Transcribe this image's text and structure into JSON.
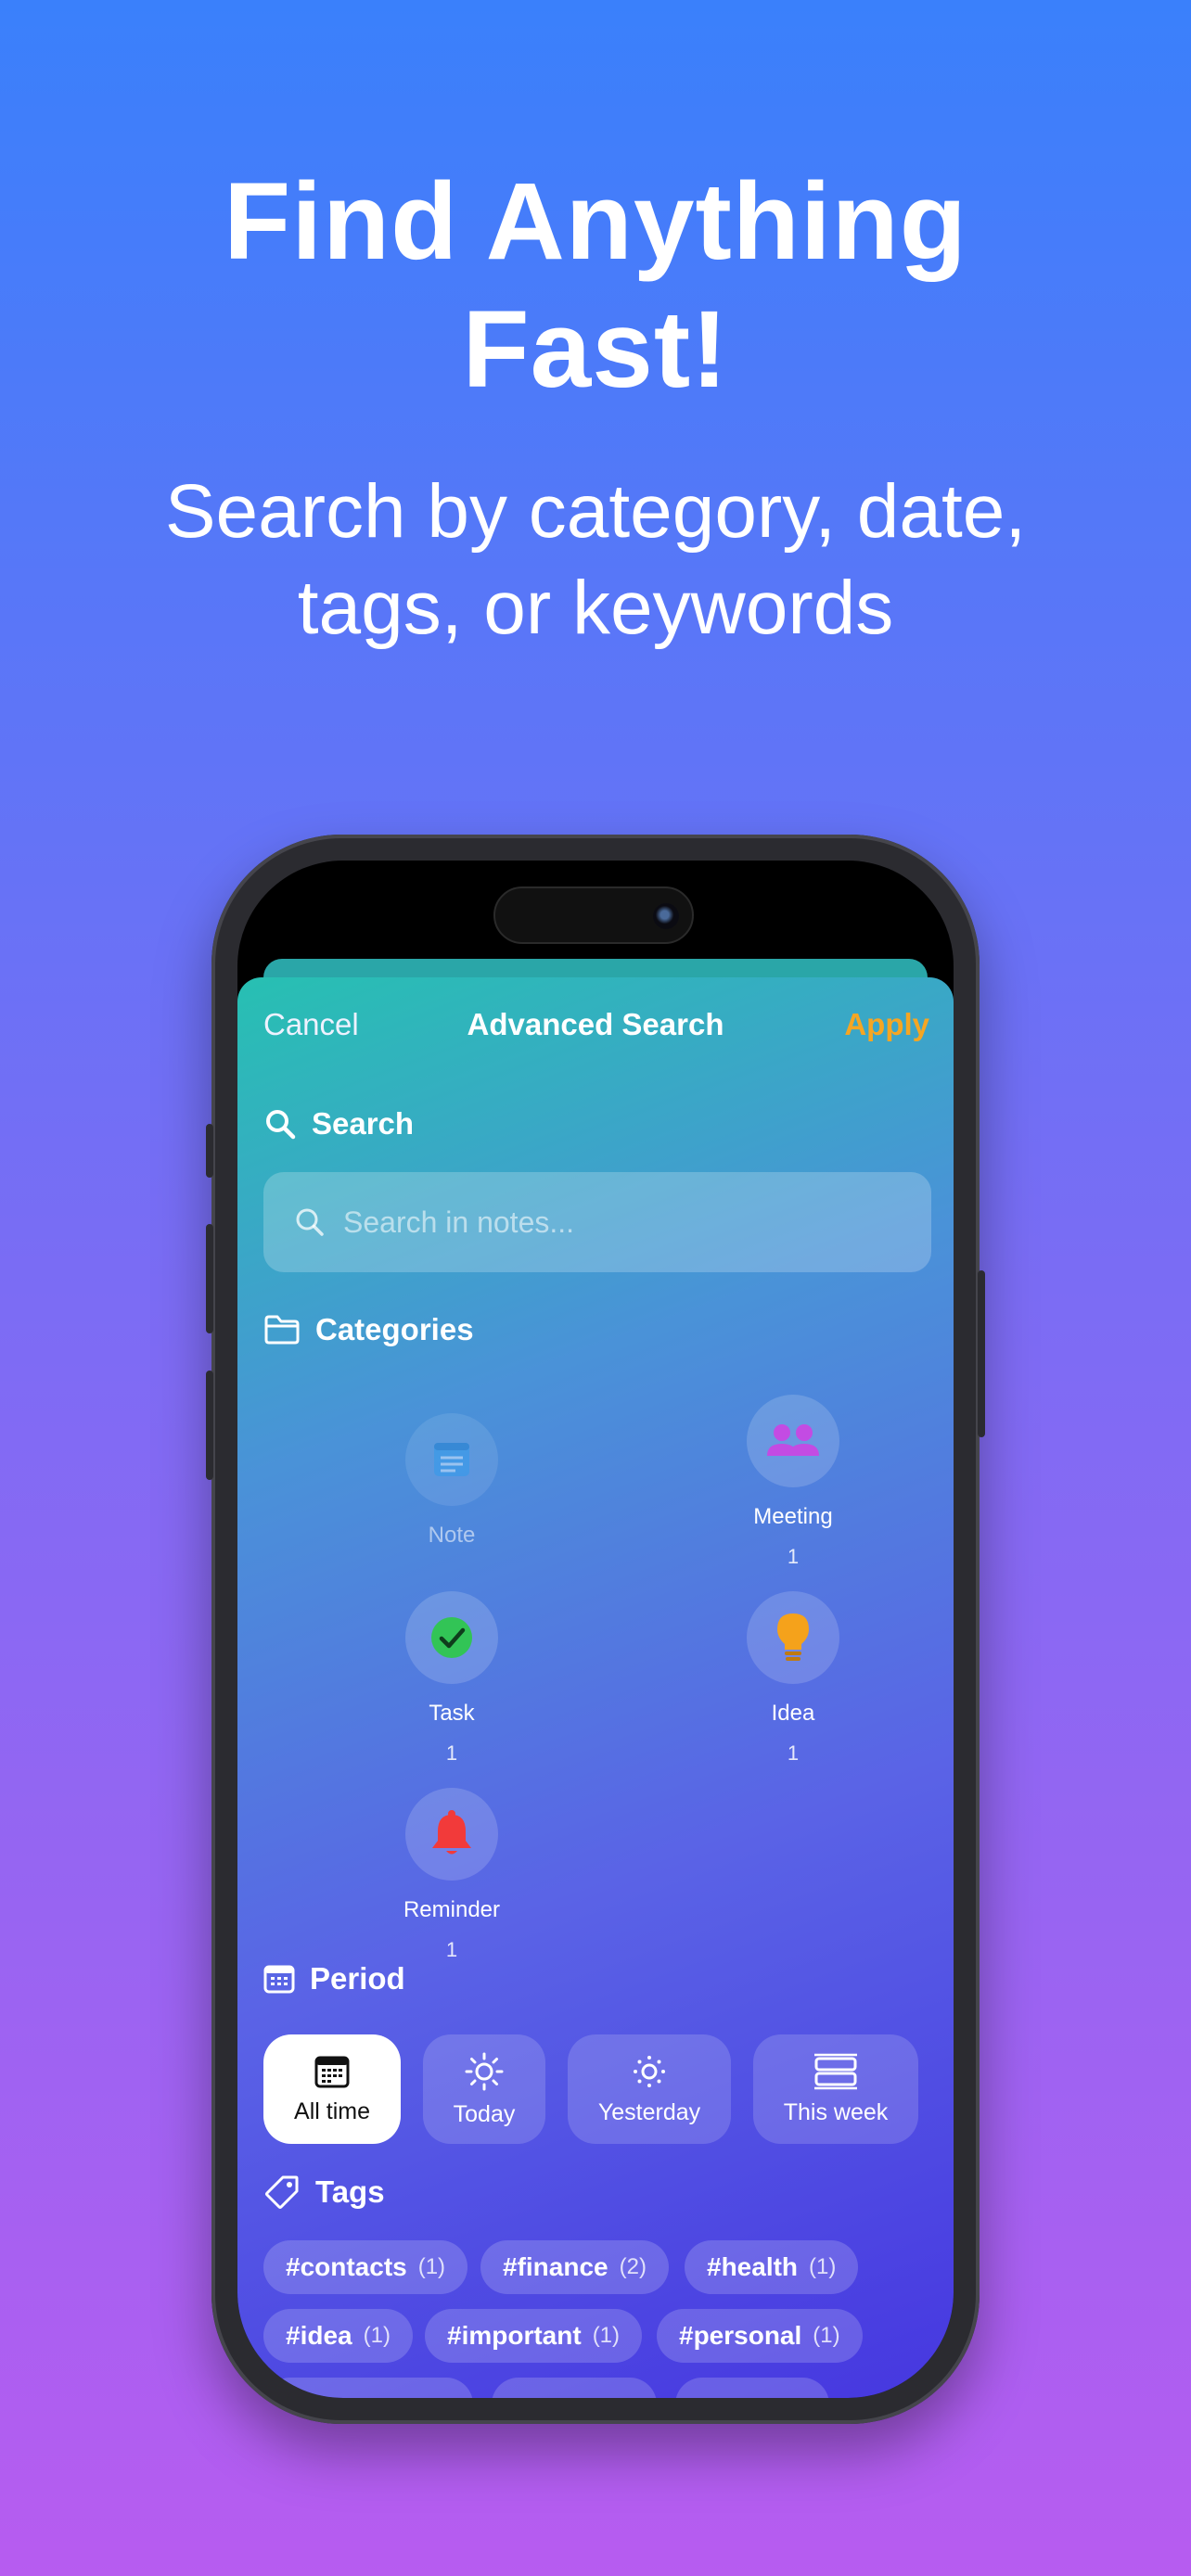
{
  "hero": {
    "title_line1": "Find Anything",
    "title_line2": "Fast!",
    "subtitle_line1": "Search by category, date,",
    "subtitle_line2": "tags, or keywords"
  },
  "nav": {
    "cancel": "Cancel",
    "title": "Advanced Search",
    "apply": "Apply",
    "apply_color": "#f5a623"
  },
  "search": {
    "heading": "Search",
    "placeholder": "Search in notes..."
  },
  "categories": {
    "heading": "Categories",
    "items": [
      {
        "name": "Note",
        "count": "",
        "icon": "note-icon"
      },
      {
        "name": "Meeting",
        "count": "1",
        "icon": "people-icon"
      },
      {
        "name": "Task",
        "count": "1",
        "icon": "checkmark-icon"
      },
      {
        "name": "Idea",
        "count": "1",
        "icon": "lightbulb-icon"
      },
      {
        "name": "Reminder",
        "count": "1",
        "icon": "bell-icon"
      }
    ]
  },
  "period": {
    "heading": "Period",
    "options": [
      {
        "label": "All time",
        "icon": "calendar-icon",
        "selected": true
      },
      {
        "label": "Today",
        "icon": "sun-icon",
        "selected": false
      },
      {
        "label": "Yesterday",
        "icon": "sun-small-icon",
        "selected": false
      },
      {
        "label": "This week",
        "icon": "week-icon",
        "selected": false
      }
    ]
  },
  "tags": {
    "heading": "Tags",
    "items": [
      {
        "name": "#contacts",
        "count": "(1)"
      },
      {
        "name": "#finance",
        "count": "(2)"
      },
      {
        "name": "#health",
        "count": "(1)"
      },
      {
        "name": "#idea",
        "count": "(1)"
      },
      {
        "name": "#important",
        "count": "(1)"
      },
      {
        "name": "#personal",
        "count": "(1)"
      }
    ]
  }
}
